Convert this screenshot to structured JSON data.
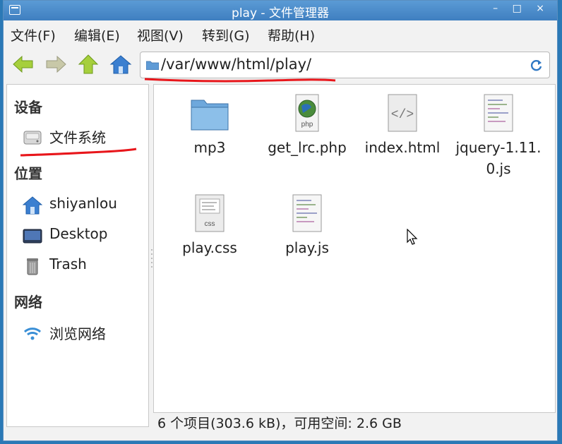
{
  "window": {
    "title": "play - 文件管理器",
    "controls": "– □ ×"
  },
  "menu": [
    {
      "label": "文件(F)"
    },
    {
      "label": "编辑(E)"
    },
    {
      "label": "视图(V)"
    },
    {
      "label": "转到(G)"
    },
    {
      "label": "帮助(H)"
    }
  ],
  "toolbar": {
    "path": "/var/www/html/play/"
  },
  "sidebar": {
    "sections": [
      {
        "heading": "设备",
        "items": [
          {
            "label": "文件系统",
            "icon": "drive-icon"
          }
        ]
      },
      {
        "heading": "位置",
        "items": [
          {
            "label": "shiyanlou",
            "icon": "home-icon"
          },
          {
            "label": "Desktop",
            "icon": "desktop-icon"
          },
          {
            "label": "Trash",
            "icon": "trash-icon"
          }
        ]
      },
      {
        "heading": "网络",
        "items": [
          {
            "label": "浏览网络",
            "icon": "network-icon"
          }
        ]
      }
    ]
  },
  "files": [
    {
      "name": "mp3",
      "icon": "folder-icon"
    },
    {
      "name": "get_lrc.php",
      "icon": "php-file-icon"
    },
    {
      "name": "index.html",
      "icon": "html-file-icon"
    },
    {
      "name": "jquery-1.11.0.js",
      "line1": "jquery-1.11.",
      "line2": "0.js",
      "icon": "js-file-icon"
    },
    {
      "name": "play.css",
      "icon": "css-file-icon"
    },
    {
      "name": "play.js",
      "icon": "js-file-icon"
    }
  ],
  "status": "6 个项目(303.6 kB)，可用空间: 2.6 GB",
  "colors": {
    "titlebar": "#4a8cca",
    "annotation": "#e8161b",
    "desktop_bg": "#2b79b6"
  }
}
